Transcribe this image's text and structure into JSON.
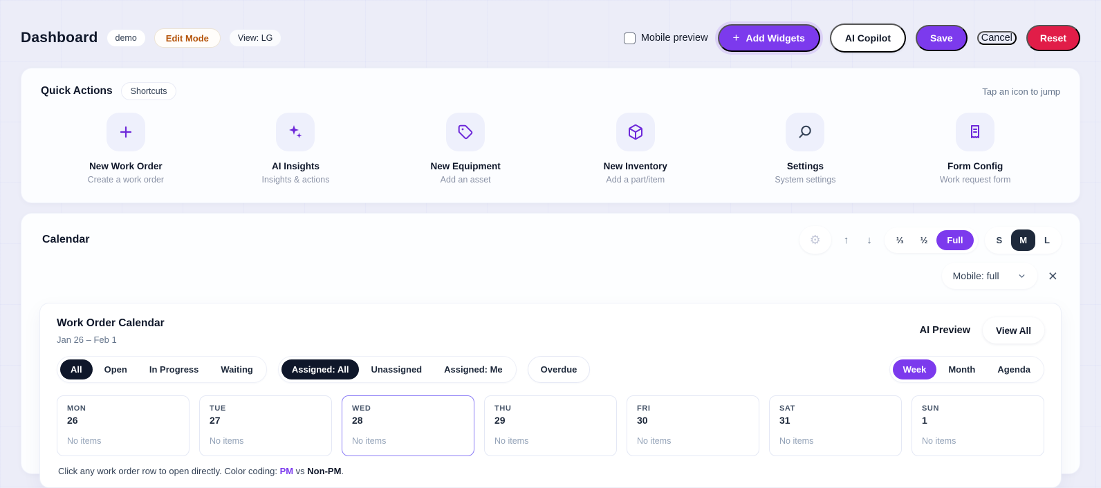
{
  "header": {
    "title": "Dashboard",
    "env_badge": "demo",
    "edit_mode_badge": "Edit Mode",
    "view_badge": "View: LG",
    "mobile_preview_label": "Mobile preview",
    "add_widgets_plus": "+",
    "add_widgets_label": "Add Widgets",
    "ai_copilot_label": "AI Copilot",
    "save_label": "Save",
    "cancel_label": "Cancel",
    "reset_label": "Reset"
  },
  "quick_actions": {
    "title": "Quick Actions",
    "badge": "Shortcuts",
    "hint": "Tap an icon to jump",
    "items": [
      {
        "icon": "plus-icon",
        "label": "New Work Order",
        "sublabel": "Create a work order"
      },
      {
        "icon": "sparkles-icon",
        "label": "AI Insights",
        "sublabel": "Insights & actions"
      },
      {
        "icon": "tag-icon",
        "label": "New Equipment",
        "sublabel": "Add an asset"
      },
      {
        "icon": "cube-icon",
        "label": "New Inventory",
        "sublabel": "Add a part/item"
      },
      {
        "icon": "magnifier-icon",
        "label": "Settings",
        "sublabel": "System settings"
      },
      {
        "icon": "document-icon",
        "label": "Form Config",
        "sublabel": "Work request form"
      }
    ]
  },
  "calendar": {
    "title": "Calendar",
    "toolbar": {
      "gear_icon": "gear",
      "move_up": "↑",
      "move_down": "↓",
      "width_third": "⅓",
      "width_half": "½",
      "width_full": "Full",
      "size_s": "S",
      "size_m": "M",
      "size_l": "L",
      "mobile_select_value": "Mobile: full",
      "close": "×"
    },
    "card": {
      "title": "Work Order Calendar",
      "date_range": "Jan 26 – Feb 1",
      "ai_preview_label": "AI Preview",
      "view_all_label": "View All",
      "status_filters": [
        "All",
        "Open",
        "In Progress",
        "Waiting"
      ],
      "status_active": "All",
      "assigned_filters": [
        "Assigned: All",
        "Unassigned",
        "Assigned: Me"
      ],
      "assigned_active": "Assigned: All",
      "overdue_label": "Overdue",
      "view_tabs": [
        "Week",
        "Month",
        "Agenda"
      ],
      "view_active": "Week",
      "days": [
        {
          "dow": "MON",
          "date": "26",
          "empty": "No items",
          "today": false
        },
        {
          "dow": "TUE",
          "date": "27",
          "empty": "No items",
          "today": false
        },
        {
          "dow": "WED",
          "date": "28",
          "empty": "No items",
          "today": true
        },
        {
          "dow": "THU",
          "date": "29",
          "empty": "No items",
          "today": false
        },
        {
          "dow": "FRI",
          "date": "30",
          "empty": "No items",
          "today": false
        },
        {
          "dow": "SAT",
          "date": "31",
          "empty": "No items",
          "today": false
        },
        {
          "dow": "SUN",
          "date": "1",
          "empty": "No items",
          "today": false
        }
      ],
      "footnote_prefix": "Click any work order row to open directly. Color coding: ",
      "footnote_pm": "PM",
      "footnote_vs": " vs ",
      "footnote_nonpm": "Non-PM",
      "footnote_suffix": "."
    }
  },
  "colors": {
    "accent_purple": "#7c3aed",
    "danger_red": "#e11d48",
    "dark_chip": "#0f172a",
    "edit_mode_text": "#b45309",
    "background": "#ecedf8",
    "today_border": "#8b7cf6"
  }
}
